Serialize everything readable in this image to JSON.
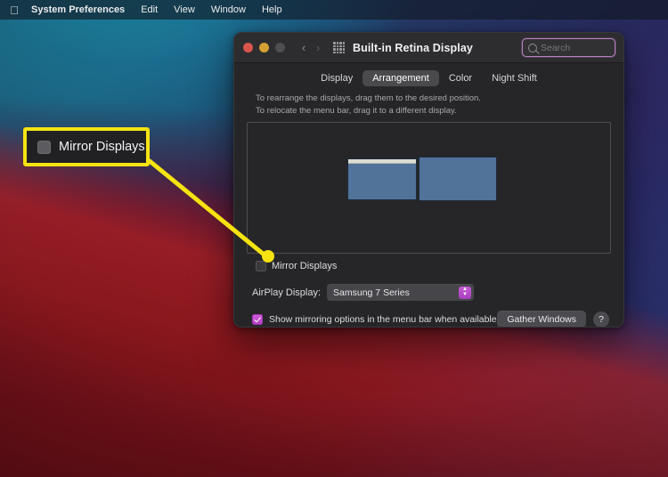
{
  "menubar": {
    "apple_icon": "apple-logo-icon",
    "items": [
      {
        "label": "System Preferences",
        "bold": true
      },
      {
        "label": "Edit",
        "bold": false
      },
      {
        "label": "View",
        "bold": false
      },
      {
        "label": "Window",
        "bold": false
      },
      {
        "label": "Help",
        "bold": false
      }
    ]
  },
  "window": {
    "title": "Built-in Retina Display",
    "traffic_lights": {
      "close": "close-button",
      "minimize": "minimize-button",
      "zoom": "zoom-button"
    },
    "nav": {
      "back": "‹",
      "forward": "›"
    },
    "grid_icon": "show-all-grid-icon",
    "search": {
      "placeholder": "Search",
      "value": "",
      "icon": "search-icon",
      "focus_ring_color": "#b97fc4"
    },
    "tabs": [
      {
        "label": "Display",
        "active": false
      },
      {
        "label": "Arrangement",
        "active": true
      },
      {
        "label": "Color",
        "active": false
      },
      {
        "label": "Night Shift",
        "active": false
      }
    ],
    "hint_line1": "To rearrange the displays, drag them to the desired position.",
    "hint_line2": "To relocate the menu bar, drag it to a different display.",
    "displays": [
      {
        "name": "primary-display",
        "has_menu_bar": true
      },
      {
        "name": "secondary-display",
        "has_menu_bar": false
      }
    ],
    "mirror": {
      "label": "Mirror Displays",
      "checked": false
    },
    "airplay": {
      "label": "AirPlay Display:",
      "selected": "Samsung 7 Series",
      "options": [
        "Samsung 7 Series"
      ],
      "stepper_color": "#b43fc6"
    },
    "show_mirroring": {
      "label": "Show mirroring options in the menu bar when available",
      "checked": true,
      "checkbox_color": "#b43fc6"
    },
    "gather_windows_label": "Gather Windows",
    "help_label": "?"
  },
  "annotation": {
    "highlight_color": "#f5e312",
    "callout": {
      "label": "Mirror Displays",
      "checkbox_checked": false
    }
  }
}
